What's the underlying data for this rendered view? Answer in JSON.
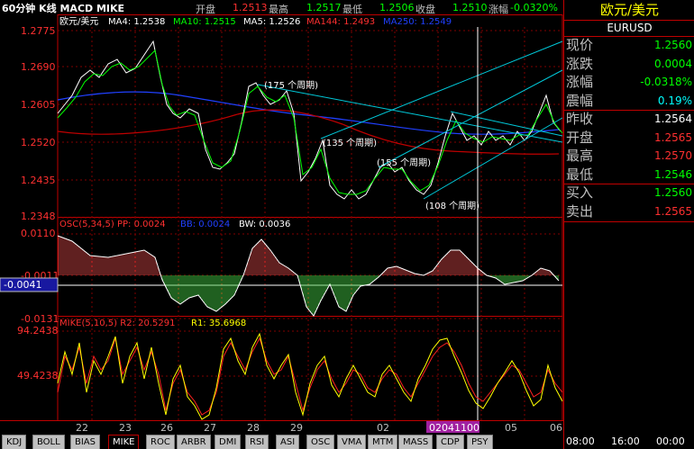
{
  "header": {
    "title": "60分钟 K线 MACD MIKE",
    "open_label": "开盘",
    "open_val": "1.2513",
    "high_label": "最高",
    "high_val": "1.2517",
    "low_label": "最低",
    "low_val": "1.2506",
    "close_label": "收盘",
    "close_val": "1.2510",
    "change_label": "涨幅",
    "change_val": "-0.0320%"
  },
  "price_panel": {
    "legend": {
      "symbol": "欧元/美元",
      "ma4": "MA4: 1.2538",
      "ma10": "MA10: 1.2515",
      "ma5": "MA5: 1.2526",
      "ma144": "MA144: 1.2493",
      "ma250": "MA250: 1.2549"
    },
    "yticks": [
      "1.2775",
      "1.2690",
      "1.2605",
      "1.2520",
      "1.2435",
      "1.2348"
    ],
    "annotations": [
      "(175 个周期)",
      "(135 个周期)",
      "(155 个周期)",
      "(108 个周期)"
    ]
  },
  "osc_panel": {
    "legend_osc": "OSC(5,34,5) PP: 0.0024",
    "legend_bb": "BB: 0.0024",
    "legend_bw": "BW: 0.0036",
    "yticks": [
      "0.0110",
      "-0.0011",
      "-0.0131"
    ],
    "current": "-0.0041"
  },
  "mike_panel": {
    "legend_mike": "MIKE(5,10,5) R2: 20.5291",
    "legend_r1": "R1: 35.6968",
    "yticks": [
      "94.2438",
      "49.4238"
    ]
  },
  "xaxis": {
    "labels": [
      "22",
      "23",
      "26",
      "27",
      "28",
      "29",
      "02",
      "05",
      "06"
    ],
    "cursor_label": "02041100"
  },
  "quote": {
    "name": "欧元/美元",
    "code": "EURUSD",
    "rows": [
      {
        "label": "现价",
        "value": "1.2560",
        "color": "#00ff00"
      },
      {
        "label": "涨跌",
        "value": "0.0004",
        "color": "#00ff00"
      },
      {
        "label": "涨幅",
        "value": "-0.0318%",
        "color": "#00ff00"
      },
      {
        "label": "震幅",
        "value": "0.19%",
        "color": "#00ffff"
      },
      {
        "label": "昨收",
        "value": "1.2564",
        "color": "#ffffff"
      },
      {
        "label": "开盘",
        "value": "1.2565",
        "color": "#ff3030"
      },
      {
        "label": "最高",
        "value": "1.2570",
        "color": "#ff3030"
      },
      {
        "label": "最低",
        "value": "1.2546",
        "color": "#00ff00"
      },
      {
        "label": "买入",
        "value": "1.2560",
        "color": "#00ff00"
      },
      {
        "label": "卖出",
        "value": "1.2565",
        "color": "#ff3030"
      }
    ]
  },
  "tabs": [
    "KDJ",
    "BOLL",
    "BIAS",
    "MIKE",
    "ROC",
    "ARBR",
    "DMI",
    "RSI",
    "ASI",
    "OSC",
    "VMA",
    "MTM",
    "MASS",
    "CDP",
    "PSY"
  ],
  "active_tab": "MIKE",
  "time_labels": [
    "08:00",
    "16:00",
    "00:00"
  ]
}
